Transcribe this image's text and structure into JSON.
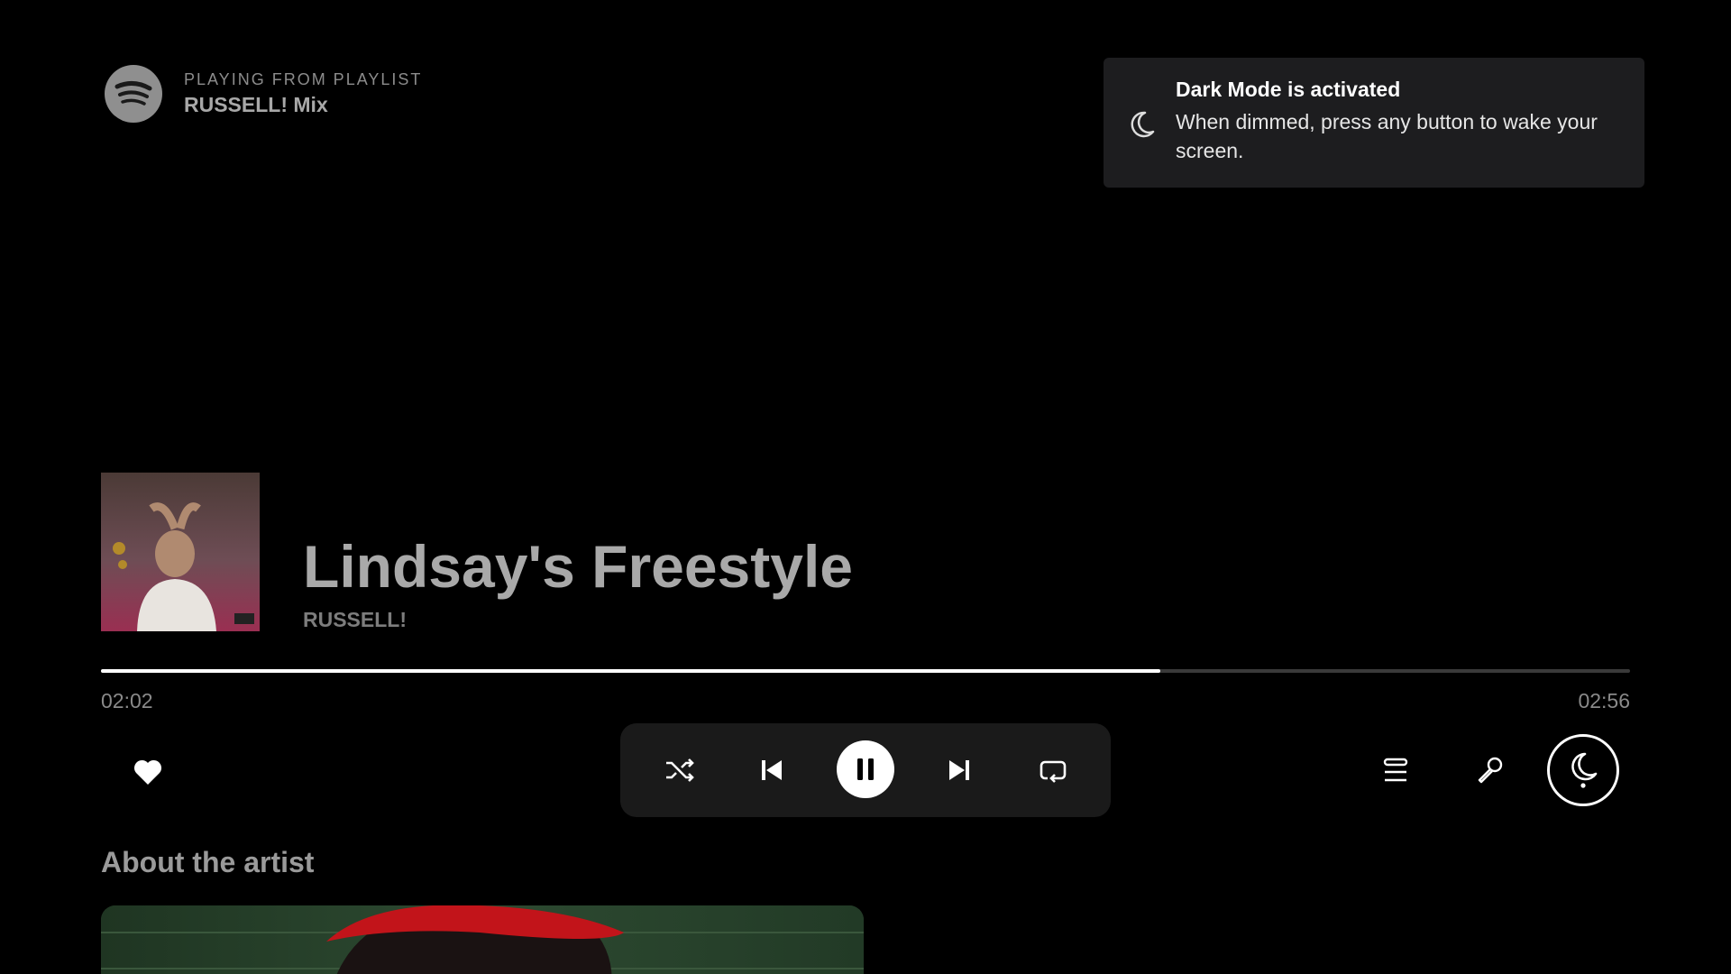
{
  "header": {
    "context_label": "PLAYING FROM PLAYLIST",
    "context_name": "RUSSELL! Mix",
    "logo_icon": "spotify-logo"
  },
  "toast": {
    "icon": "moon-icon",
    "title": "Dark Mode is activated",
    "body": "When dimmed, press any button to wake your screen."
  },
  "track": {
    "title": "Lindsay's Freestyle",
    "artist": "RUSSELL!",
    "cover_icon": "album-cover"
  },
  "playback": {
    "elapsed": "02:02",
    "total": "02:56",
    "progress": 0.693
  },
  "controls": {
    "like": "heart-icon",
    "shuffle": "shuffle-icon",
    "previous": "skip-back-icon",
    "pause": "pause-icon",
    "next": "skip-forward-icon",
    "repeat": "repeat-icon",
    "queue": "queue-icon",
    "lyrics": "microphone-icon",
    "dark_mode": "moon-icon"
  },
  "about": {
    "heading": "About the artist"
  },
  "colors": {
    "background": "#000000",
    "toast_bg": "#1d1d1f",
    "controls_bg": "#1a1a1a",
    "progress_fill": "#ffffff"
  }
}
